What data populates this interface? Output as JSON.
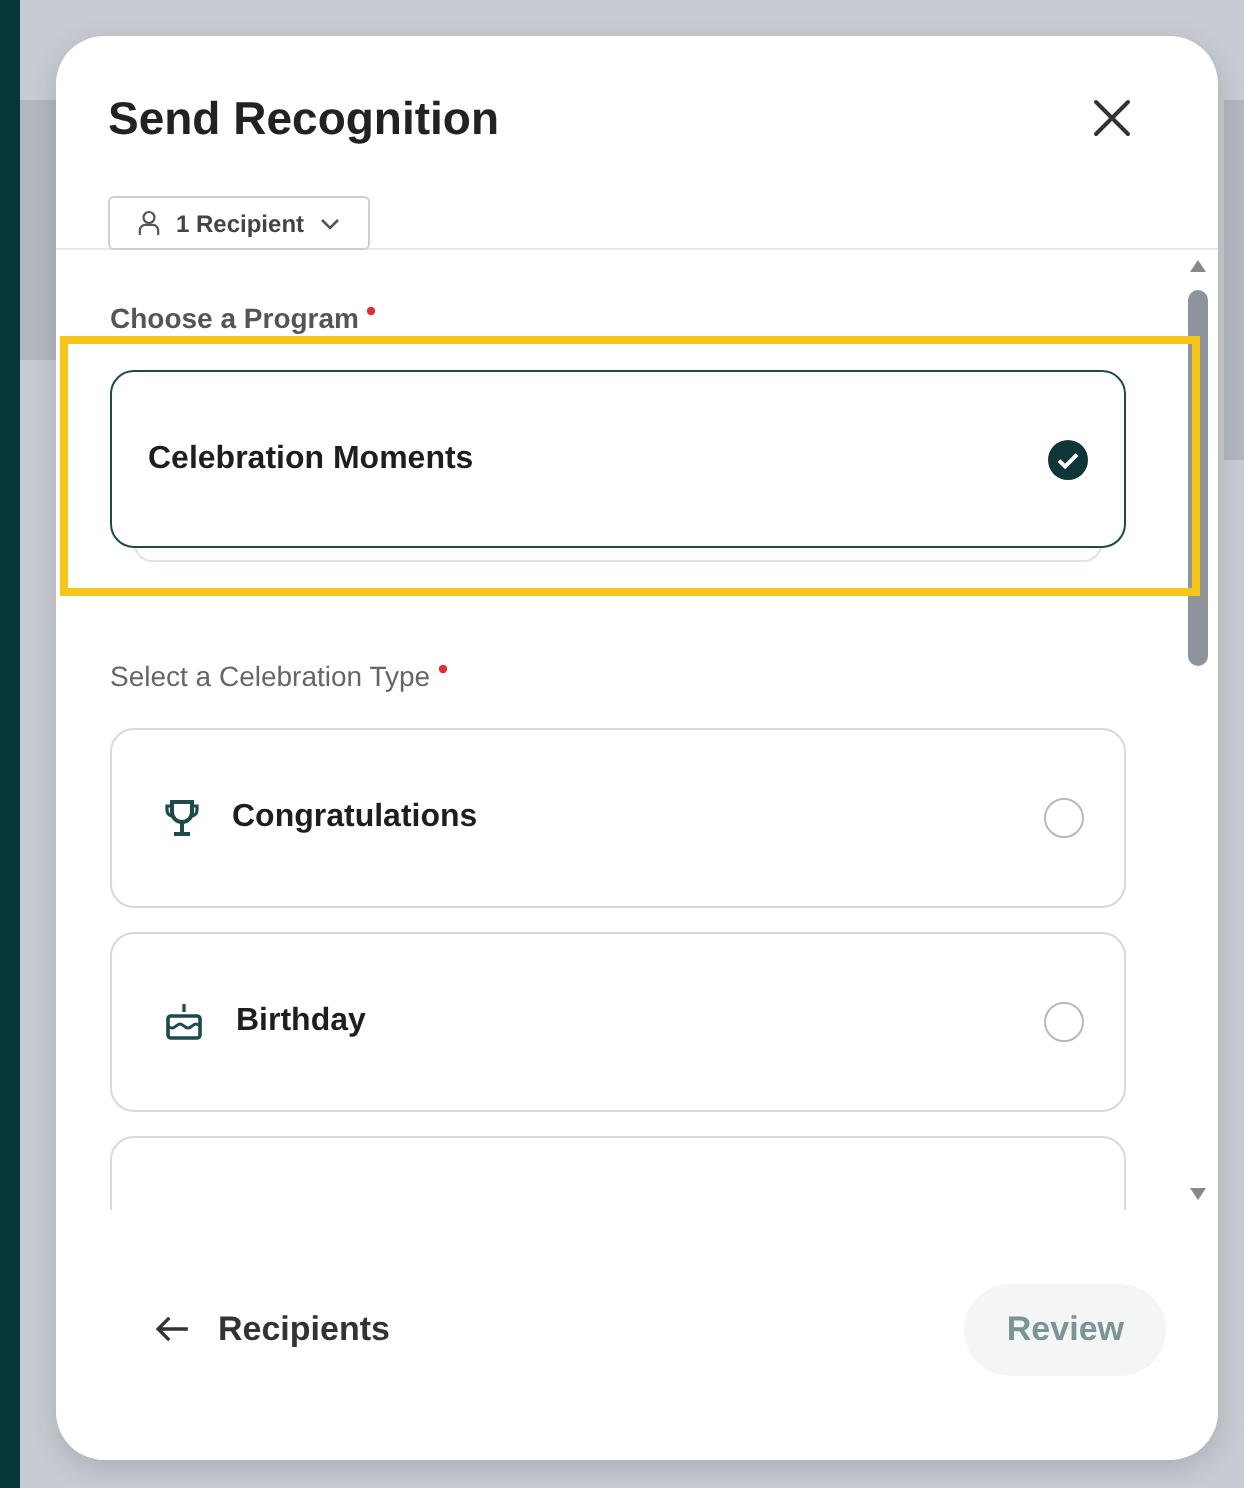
{
  "dialog": {
    "title": "Send Recognition",
    "recipients": "1 Recipient",
    "program_section": {
      "label": "Choose a Program",
      "required": true,
      "highlighted": true,
      "programs": [
        {
          "label": "Celebration Moments",
          "selected": true
        }
      ]
    },
    "type_section": {
      "label": "Select a Celebration Type",
      "required": true,
      "types": [
        {
          "kind": "trophy",
          "label": "Congratulations",
          "selected": false
        },
        {
          "kind": "cake",
          "label": "Birthday",
          "selected": false
        },
        {
          "kind": "partial"
        }
      ]
    },
    "footer": {
      "back": "Recipients",
      "next": {
        "label": "Review",
        "disabled": true
      }
    }
  }
}
